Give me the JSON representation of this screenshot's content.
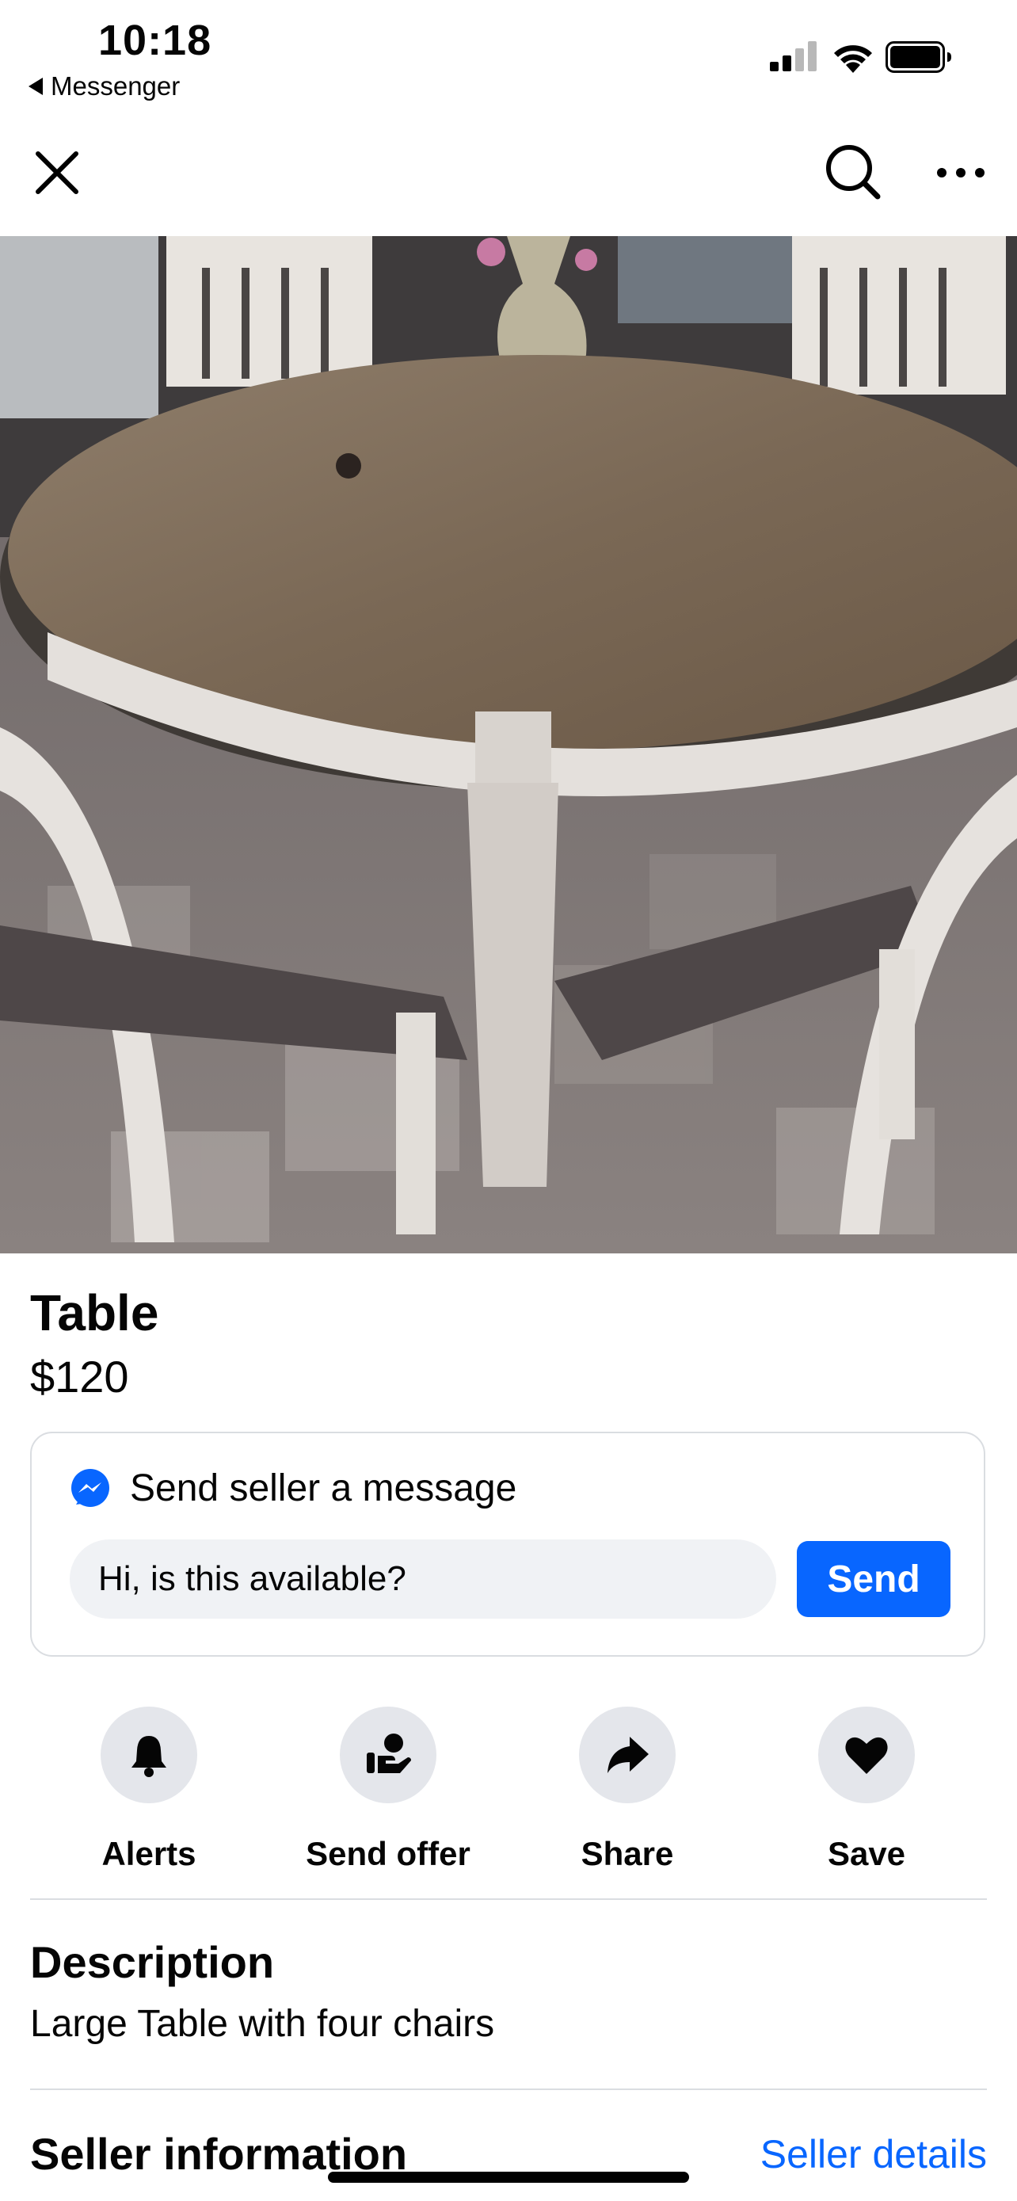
{
  "status_bar": {
    "time": "10:18",
    "back_app": "Messenger"
  },
  "listing": {
    "title": "Table",
    "price": "$120"
  },
  "message_card": {
    "header": "Send seller a message",
    "input_value": "Hi, is this available?",
    "send_label": "Send"
  },
  "actions": [
    {
      "label": "Alerts",
      "icon": "bell-icon"
    },
    {
      "label": "Send offer",
      "icon": "hand-offer-icon"
    },
    {
      "label": "Share",
      "icon": "share-arrow-icon"
    },
    {
      "label": "Save",
      "icon": "heart-icon"
    }
  ],
  "description": {
    "heading": "Description",
    "text": "Large Table with four chairs"
  },
  "seller": {
    "heading": "Seller information",
    "link": "Seller details"
  },
  "colors": {
    "accent": "#0866ff",
    "surface": "#f0f2f5",
    "icon_bg": "#e4e6eb",
    "divider": "#dadde1"
  }
}
